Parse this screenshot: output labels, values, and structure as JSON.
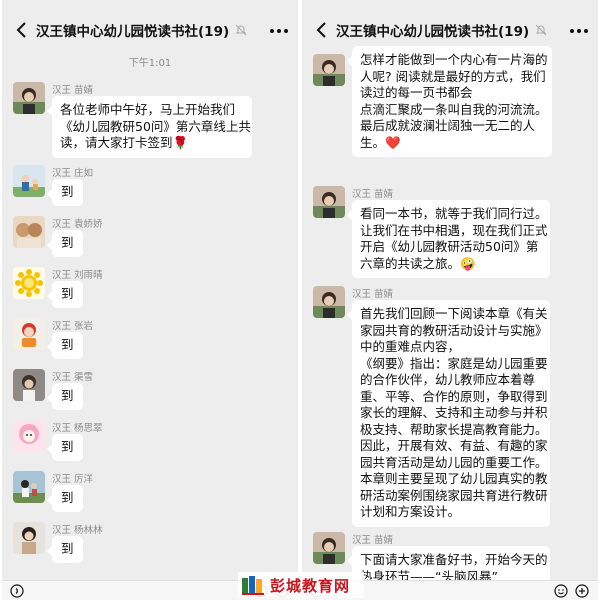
{
  "app": {
    "chat_title": "汉王镇中心幼儿园悦读书社(19)"
  },
  "left": {
    "time": "下午1:01",
    "messages": [
      {
        "sender": "汉王 苗婧",
        "lines": [
          "各位老师中午好，马上开始我们",
          "《幼儿园教研50问》第六章线上共",
          "读，请大家打卡签到🌹"
        ]
      },
      {
        "sender": "汉王 庄如",
        "text": "到"
      },
      {
        "sender": "汉王 袁娇娇",
        "text": "到"
      },
      {
        "sender": "汉王 刘雨晴",
        "text": "到"
      },
      {
        "sender": "汉王 张岩",
        "text": "到"
      },
      {
        "sender": "汉王 渠雪",
        "text": "到"
      },
      {
        "sender": "汉王 杨思翠",
        "text": "到"
      },
      {
        "sender": "汉王 厉洋",
        "text": "到"
      },
      {
        "sender": "汉王 杨林林",
        "text": "到"
      }
    ]
  },
  "right": {
    "messages": [
      {
        "sender": "",
        "lines": [
          "怎样才能做到一个内心有一片海的",
          "人呢? 阅读就是最好的方式，我们",
          "读过的每一页书都会",
          "点滴汇聚成一条叫自我的河流流。",
          "最后成就波澜壮阔独一无二的人",
          "生。❤️"
        ]
      },
      {
        "sender": "汉王 苗婧",
        "lines": [
          "看同一本书，就等于我们同行过。",
          "让我们在书中相遇，现在我们正式",
          "开启《幼儿园教研活动50问》第",
          "六章的共读之旅。🤪"
        ]
      },
      {
        "sender": "汉王 苗婧",
        "lines": [
          "首先我们回顾一下阅读本章《有关",
          "家园共育的教研活动设计与实施》",
          "中的重难点内容，",
          "《纲要》指出：家庭是幼儿园重要",
          "的合作伙伴，幼儿教师应本着尊",
          "重、平等、合作的原则，争取得到",
          "家长的理解、支持和主动参与并积",
          "极支持、帮助家长提高教育能力。",
          "因此，开展有效、有益、有趣的家",
          "园共育活动是幼儿园的重要工作。",
          "本章则主要呈现了幼儿园真实的教",
          "研活动案例围绕家园共育进行教研",
          "计划和方案设计。"
        ]
      },
      {
        "sender": "汉王 苗婧",
        "lines": [
          "下面请大家准备好书，开始今天的",
          "热身环节——“头脑风暴”"
        ]
      }
    ]
  },
  "watermark": {
    "text": "彭城教育网"
  },
  "colors": {
    "chat_bg": "#ededed",
    "bubble": "#ffffff",
    "watermark": "#c8161d"
  },
  "icons": {
    "back": "chevron-left-icon",
    "mute": "bell-off-icon",
    "more": "more-dots-icon"
  }
}
